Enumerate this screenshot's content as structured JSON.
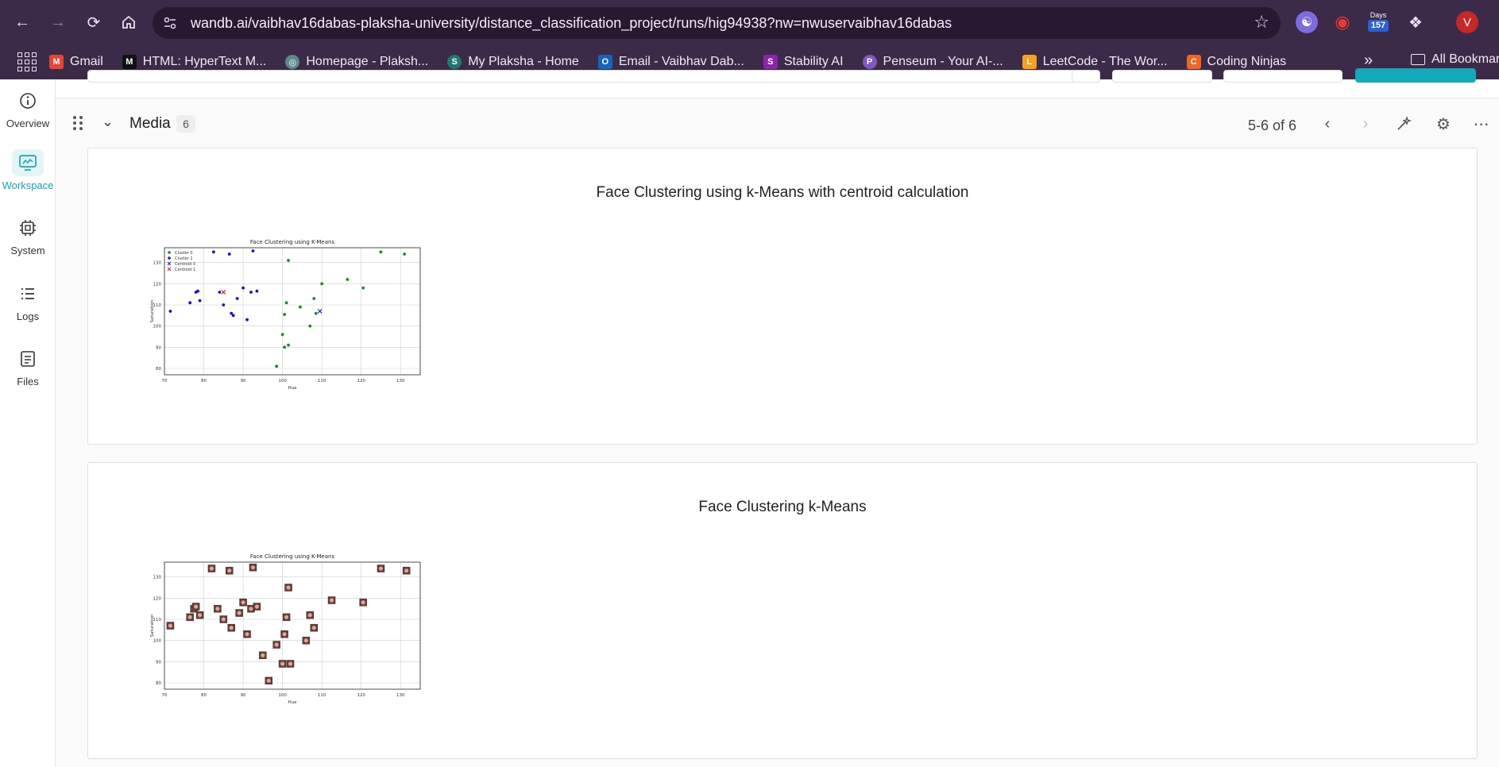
{
  "browser": {
    "url": "wandb.ai/vaibhav16dabas-plaksha-university/distance_classification_project/runs/hig94938?nw=nwuservaibhav16dabas",
    "days_label": "Days",
    "days_value": "157",
    "avatar_letter": "V",
    "bookmarks": [
      {
        "label": "Gmail",
        "color": "#ea4335",
        "glyph": "M"
      },
      {
        "label": "HTML: HyperText M...",
        "color": "#222222",
        "glyph": "M"
      },
      {
        "label": "Homepage - Plaksh...",
        "color": "#5c8a8a",
        "glyph": "◎"
      },
      {
        "label": "My Plaksha - Home",
        "color": "#1e7a6d",
        "glyph": "S"
      },
      {
        "label": "Email - Vaibhav Dab...",
        "color": "#1565c0",
        "glyph": "O"
      },
      {
        "label": "Stability AI",
        "color": "#8e24aa",
        "glyph": "S"
      },
      {
        "label": "Penseum - Your AI-...",
        "color": "#7e57c2",
        "glyph": "P"
      },
      {
        "label": "LeetCode - The Wor...",
        "color": "#f89f1b",
        "glyph": "L"
      },
      {
        "label": "Coding Ninjas",
        "color": "#f06522",
        "glyph": "C"
      }
    ],
    "all_bookmarks": "All Bookmar"
  },
  "sidebar": {
    "items": [
      {
        "label": "Overview",
        "icon": "info-icon"
      },
      {
        "label": "Workspace",
        "icon": "workspace-icon"
      },
      {
        "label": "System",
        "icon": "chip-icon"
      },
      {
        "label": "Logs",
        "icon": "list-icon"
      },
      {
        "label": "Files",
        "icon": "file-icon"
      }
    ]
  },
  "section": {
    "title": "Media",
    "count": "6",
    "pager": "5-6 of 6"
  },
  "panels": [
    {
      "title": "Face Clustering using k-Means with centroid calculation",
      "plot_title": "Face Clustering using K-Means",
      "legend": [
        "Cluster 0",
        "Cluster 1",
        "Centroid 0",
        "Centroid 1"
      ]
    },
    {
      "title": "Face Clustering k-Means",
      "plot_title": "Face Clustering using K-Means"
    }
  ],
  "chart_data": [
    {
      "type": "scatter",
      "title": "Face Clustering using K-Means",
      "xlabel": "Hue",
      "ylabel": "Saturation",
      "xlim": [
        70,
        135
      ],
      "ylim": [
        77,
        137
      ],
      "xticks": [
        "70",
        "80",
        "90",
        "100",
        "110",
        "120",
        "130"
      ],
      "yticks": [
        "80",
        "90",
        "100",
        "110",
        "120",
        "130"
      ],
      "legend_position": "upper left",
      "grid": true,
      "series": [
        {
          "name": "Cluster 0",
          "color": "#1a8a1a",
          "marker": "dot",
          "points": [
            [
              101.5,
              131
            ],
            [
              101,
              111
            ],
            [
              100.5,
              105.5
            ],
            [
              100,
              96
            ],
            [
              100.5,
              90
            ],
            [
              101.5,
              91
            ],
            [
              98.5,
              81
            ],
            [
              104.5,
              109
            ],
            [
              107,
              100
            ],
            [
              108,
              113
            ],
            [
              108.5,
              106
            ],
            [
              110,
              120
            ],
            [
              116.5,
              122
            ],
            [
              120.5,
              118
            ],
            [
              125,
              135
            ],
            [
              131,
              134
            ]
          ]
        },
        {
          "name": "Cluster 1",
          "color": "#1010e0",
          "marker": "dot",
          "points": [
            [
              71.5,
              107
            ],
            [
              76.5,
              111
            ],
            [
              78,
              116
            ],
            [
              78.5,
              116.5
            ],
            [
              79,
              112
            ],
            [
              82.5,
              135
            ],
            [
              84,
              116
            ],
            [
              85,
              110
            ],
            [
              86.5,
              134
            ],
            [
              87,
              106
            ],
            [
              87.5,
              105
            ],
            [
              88.5,
              113
            ],
            [
              90,
              118
            ],
            [
              91,
              103
            ],
            [
              92,
              116
            ],
            [
              92.5,
              135.5
            ],
            [
              93.5,
              116.5
            ]
          ]
        },
        {
          "name": "Centroid 0",
          "color": "#1010e0",
          "marker": "x",
          "points": [
            [
              109.5,
              107
            ]
          ]
        },
        {
          "name": "Centroid 1",
          "color": "#e01010",
          "marker": "x",
          "points": [
            [
              85,
              116
            ]
          ]
        }
      ]
    },
    {
      "type": "scatter",
      "title": "Face Clustering using K-Means",
      "xlabel": "Hue",
      "ylabel": "Saturation",
      "xlim": [
        70,
        135
      ],
      "ylim": [
        77,
        137
      ],
      "xticks": [
        "70",
        "80",
        "90",
        "100",
        "110",
        "120",
        "130"
      ],
      "yticks": [
        "80",
        "90",
        "100",
        "110",
        "120",
        "130"
      ],
      "grid": true,
      "marker": "face-thumbnail",
      "series": [
        {
          "name": "",
          "points": [
            [
              71.5,
              107
            ],
            [
              76.5,
              111
            ],
            [
              77.5,
              115
            ],
            [
              78,
              116
            ],
            [
              79,
              112
            ],
            [
              82,
              134
            ],
            [
              83.5,
              115
            ],
            [
              85,
              110
            ],
            [
              86.5,
              133
            ],
            [
              87,
              106
            ],
            [
              89,
              113
            ],
            [
              90,
              118
            ],
            [
              91,
              103
            ],
            [
              92,
              115
            ],
            [
              92.5,
              134.5
            ],
            [
              93.5,
              116
            ],
            [
              95,
              93
            ],
            [
              96.5,
              81
            ],
            [
              98.5,
              98
            ],
            [
              100,
              89
            ],
            [
              100.5,
              103
            ],
            [
              101,
              111
            ],
            [
              101.5,
              125
            ],
            [
              102,
              89
            ],
            [
              106,
              100
            ],
            [
              107,
              112
            ],
            [
              108,
              106
            ],
            [
              112.5,
              119
            ],
            [
              120.5,
              118
            ],
            [
              125,
              134
            ],
            [
              131.5,
              133
            ]
          ]
        }
      ]
    }
  ]
}
